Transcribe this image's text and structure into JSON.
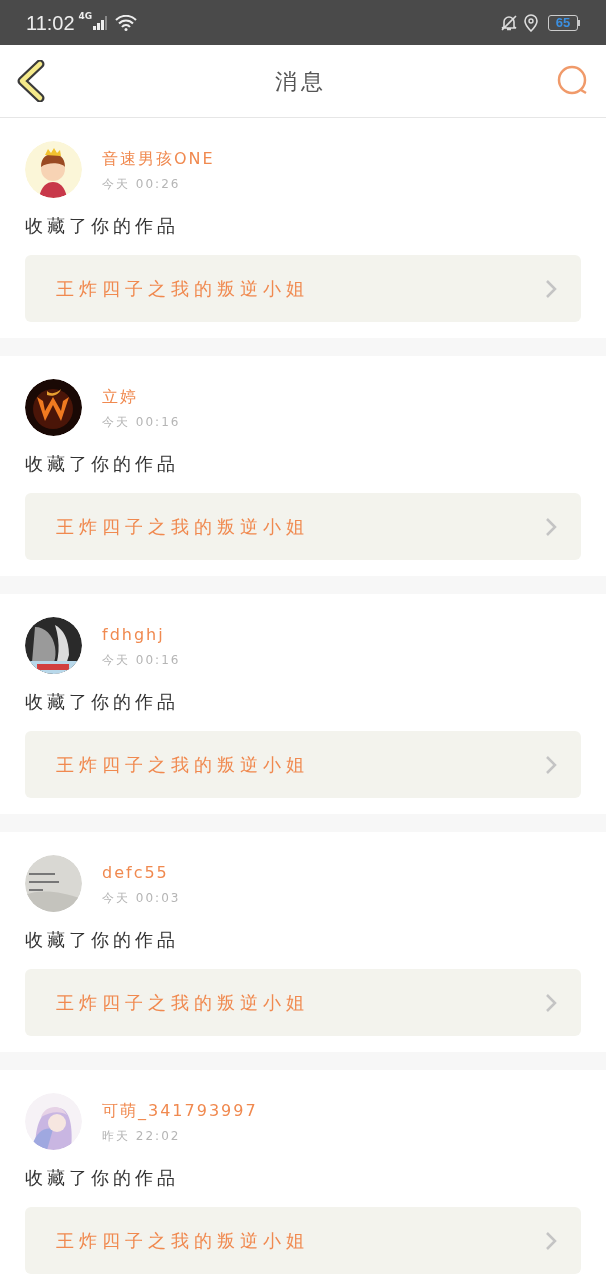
{
  "status_bar": {
    "time": "11:02",
    "network": "4G",
    "battery": "65"
  },
  "header": {
    "title": "消息"
  },
  "messages": [
    {
      "user": "音速男孩ONE",
      "time": "今天 00:26",
      "action": "收藏了你的作品",
      "work_title": "王炸四子之我的叛逆小姐"
    },
    {
      "user": "立婷",
      "time": "今天 00:16",
      "action": "收藏了你的作品",
      "work_title": "王炸四子之我的叛逆小姐"
    },
    {
      "user": "fdhghj",
      "time": "今天 00:16",
      "action": "收藏了你的作品",
      "work_title": "王炸四子之我的叛逆小姐"
    },
    {
      "user": "defc55",
      "time": "今天 00:03",
      "action": "收藏了你的作品",
      "work_title": "王炸四子之我的叛逆小姐"
    },
    {
      "user": "可萌_341793997",
      "time": "昨天 22:02",
      "action": "收藏了你的作品",
      "work_title": "王炸四子之我的叛逆小姐"
    }
  ]
}
